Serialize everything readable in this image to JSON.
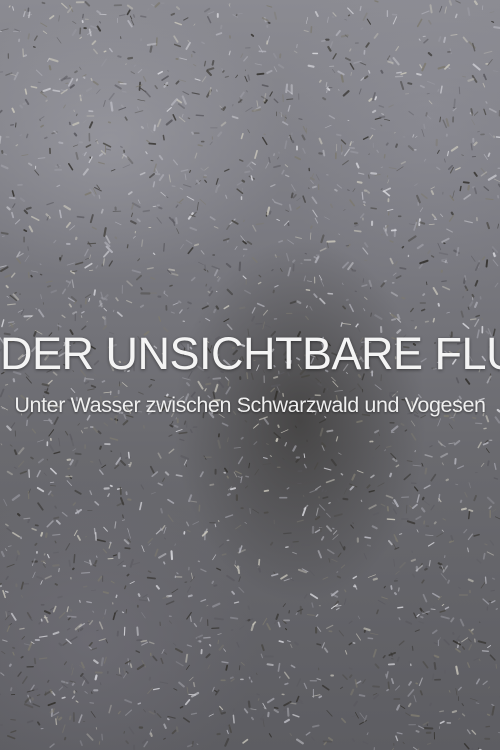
{
  "poster": {
    "title": "DER UNSICHTBARE FLUSS",
    "subtitle": "Unter Wasser zwischen Schwarzwald und Vogesen"
  }
}
